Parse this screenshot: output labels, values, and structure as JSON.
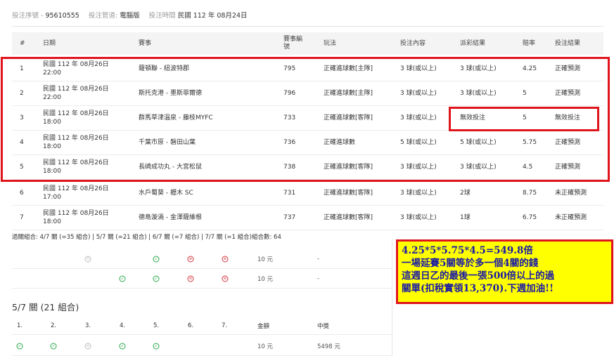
{
  "meta": {
    "bet_no_label": "投注序號 - ",
    "bet_no_value": "95610555",
    "channel_label": "投注管道:",
    "channel_value": "電腦版",
    "time_label": "投注時間",
    "time_value": "民國 112 年 08月24日"
  },
  "table": {
    "headers": [
      "#",
      "日期",
      "賽事",
      "賽事編號",
      "玩法",
      "投注內容",
      "派彩結果",
      "賠率",
      "投注結果"
    ],
    "rows": [
      {
        "n": "1",
        "date1": "民國 112 年 08月26日",
        "date2": "22:00",
        "match": "薩頓聯 - 紐波特郡",
        "id": "795",
        "play": "正確進球數[主隊]",
        "bet": "3 球(或以上)",
        "result": "3 球(或以上)",
        "odds": "4.25",
        "status": "正確預測"
      },
      {
        "n": "2",
        "date1": "民國 112 年 08月26日",
        "date2": "22:00",
        "match": "斯托克港 - 墨斯菲爾德",
        "id": "796",
        "play": "正確進球數[主隊]",
        "bet": "3 球(或以上)",
        "result": "3 球(或以上)",
        "odds": "5",
        "status": "正確預測"
      },
      {
        "n": "3",
        "date1": "民國 112 年 08月26日",
        "date2": "18:00",
        "match": "群馬草津溫泉 - 藤枝MYFC",
        "id": "733",
        "play": "正確進球數[客隊]",
        "bet": "3 球(或以上)",
        "result": "無效投注",
        "odds": "5",
        "status": "無效投注"
      },
      {
        "n": "4",
        "date1": "民國 112 年 08月26日",
        "date2": "18:00",
        "match": "千葉市原 - 磐田山葉",
        "id": "736",
        "play": "正確進球數",
        "bet": "5 球(或以上)",
        "result": "5 球(或以上)",
        "odds": "5.75",
        "status": "正確預測"
      },
      {
        "n": "5",
        "date1": "民國 112 年 08月26日",
        "date2": "18:00",
        "match": "長崎成功丸 - 大宮松鼠",
        "id": "738",
        "play": "正確進球數[客隊]",
        "bet": "3 球(或以上)",
        "result": "3 球(或以上)",
        "odds": "4.5",
        "status": "正確預測"
      },
      {
        "n": "6",
        "date1": "民國 112 年 08月26日",
        "date2": "17:00",
        "match": "水戶蜀葵 - 櫪木 SC",
        "id": "731",
        "play": "正確進球數[客隊]",
        "bet": "3 球(或以上)",
        "result": "2球",
        "odds": "8.75",
        "status": "未正確預測"
      },
      {
        "n": "7",
        "date1": "民國 112 年 08月26日",
        "date2": "18:00",
        "match": "德島漩渦 - 金澤薩維根",
        "id": "737",
        "play": "正確進球數[客隊]",
        "bet": "3 球(或以上)",
        "result": "1球",
        "odds": "6.75",
        "status": "未正確預測"
      }
    ]
  },
  "combo_summary": "過關組合: 4/7 關 (=35 組合) | 5/7 關 (=21 組合) | 6/7 關 (=7 組合) | 7/7 關 (=1 組合)組合數: 64",
  "combo_rows": [
    {
      "marks": [
        "",
        "",
        "na",
        "",
        "ok",
        "no",
        "no"
      ],
      "amount": "10 元",
      "prize": "-"
    },
    {
      "marks": [
        "",
        "",
        "ok",
        "",
        "ok",
        "no",
        "no"
      ],
      "amount": "10 元",
      "prize": "-"
    }
  ],
  "section": {
    "title": "5/7 關 (21 組合)",
    "headers": [
      "1.",
      "2.",
      "3.",
      "4.",
      "5.",
      "6.",
      "7.",
      "金額",
      "中獎"
    ],
    "row": {
      "marks": [
        "ok",
        "ok",
        "na",
        "ok",
        "ok",
        "",
        ""
      ],
      "amount": "10 元",
      "prize": "5498 元"
    }
  },
  "note": {
    "line1": "4.25*5*5.75*4.5=549.8倍",
    "line2": "一場延賽5關等於多一個4關的錢",
    "line3": "這週日乙的最後一張500倍以上的過",
    "line4": "關單(扣稅實領13,370).下週加油!!"
  },
  "colors": {
    "highlight_border": "#e0141c",
    "note_bg": "#ffff00",
    "note_text": "#1a1aa6",
    "ok": "#2aa84a",
    "fail": "#d9363e"
  },
  "icons": {
    "ok": "check-circle-icon",
    "no": "cross-circle-icon",
    "na": "void-circle-icon"
  }
}
